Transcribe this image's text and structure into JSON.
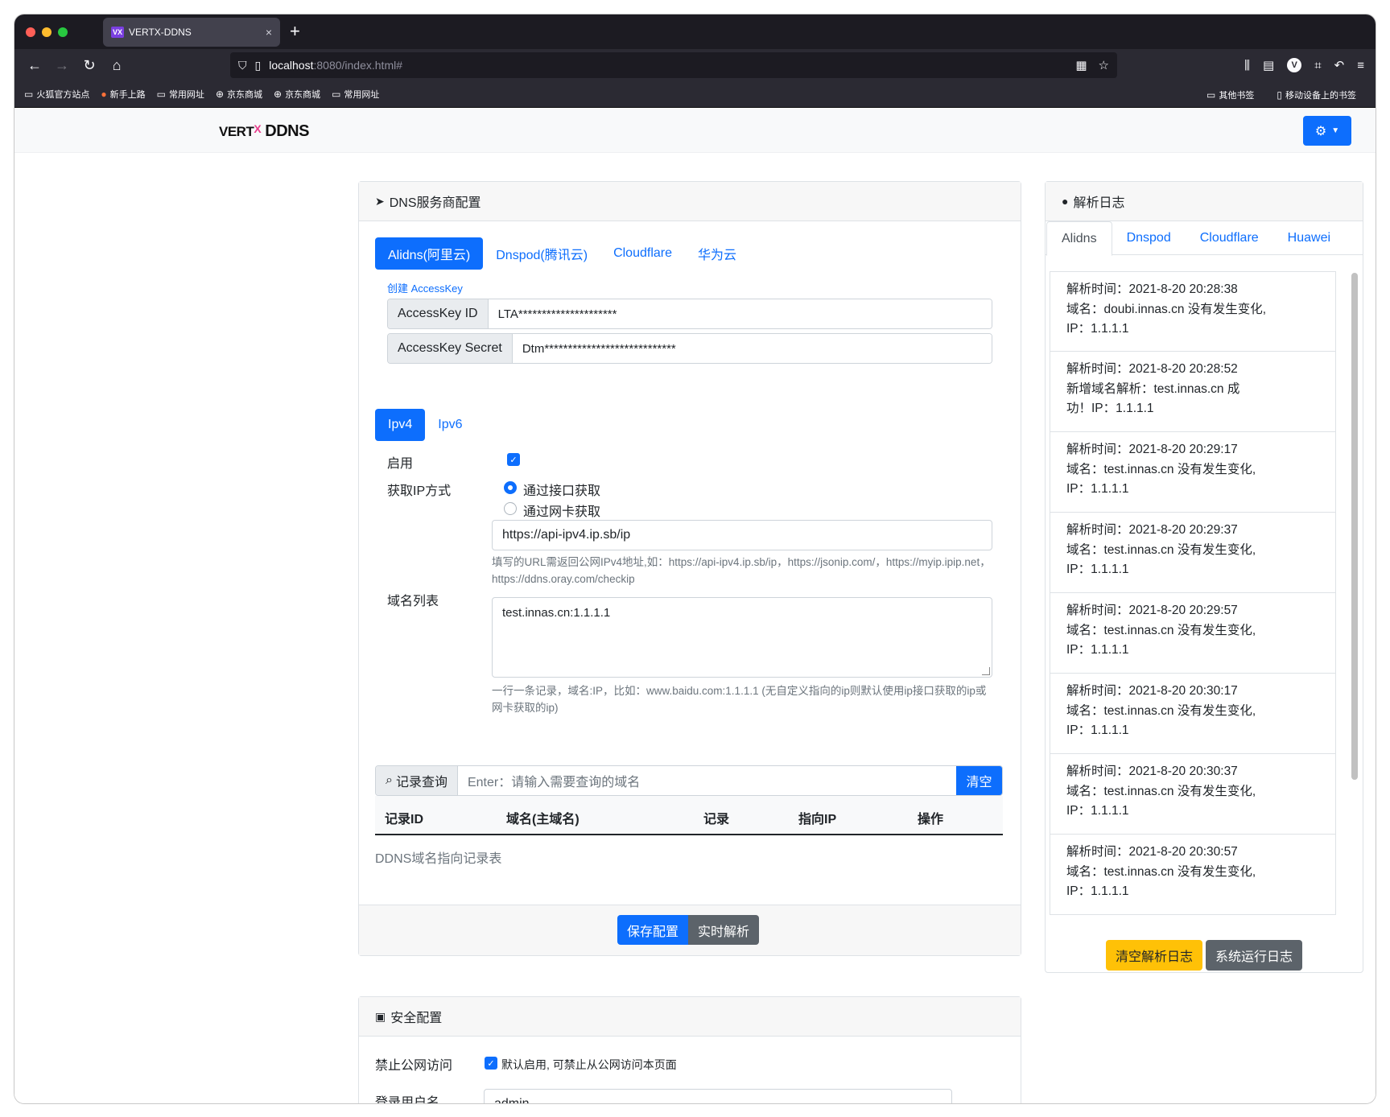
{
  "browser": {
    "tab_title": "VERTX-DDNS",
    "tab_favicon": "VX",
    "tab_close": "×",
    "new_tab": "+",
    "url_host": "localhost",
    "url_rest": ":8080/index.html#",
    "bookmarks": [
      {
        "icon": "folder-icon",
        "label": "火狐官方站点"
      },
      {
        "icon": "firefox-icon",
        "label": "新手上路"
      },
      {
        "icon": "folder-icon",
        "label": "常用网址"
      },
      {
        "icon": "globe-icon",
        "label": "京东商城"
      },
      {
        "icon": "globe-icon",
        "label": "京东商城"
      },
      {
        "icon": "folder-icon",
        "label": "常用网址"
      }
    ],
    "bookmarks_right": [
      {
        "icon": "folder-icon",
        "label": "其他书签"
      },
      {
        "icon": "mobile-icon",
        "label": "移动设备上的书签"
      }
    ],
    "extension_letter": "V"
  },
  "app": {
    "logo_main": "VERT",
    "logo_x": "X",
    "logo_suffix": "DDNS"
  },
  "dns_card": {
    "title": "DNS服务商配置",
    "provider_tabs": [
      "Alidns(阿里云)",
      "Dnspod(腾讯云)",
      "Cloudflare",
      "华为云"
    ],
    "active_provider": "Alidns(阿里云)",
    "create_key_link": "创建 AccessKey",
    "access_key_id_label": "AccessKey ID",
    "access_key_id_value": "LTA*********************",
    "access_key_secret_label": "AccessKey Secret",
    "access_key_secret_value": "Dtm****************************",
    "ip_tabs": [
      "Ipv4",
      "Ipv6"
    ],
    "enable_label": "启用",
    "get_ip_label": "获取IP方式",
    "radio_api": "通过接口获取",
    "radio_nic": "通过网卡获取",
    "api_url": "https://api-ipv4.ip.sb/ip",
    "api_help": "填写的URL需返回公网IPv4地址,如：https://api-ipv4.ip.sb/ip，https://jsonip.com/，https://myip.ipip.net，https://ddns.oray.com/checkip",
    "domain_list_label": "域名列表",
    "domain_list_value": "test.innas.cn:1.1.1.1",
    "domain_help": "一行一条记录，域名:IP，比如：www.baidu.com:1.1.1.1 (无自定义指向的ip则默认使用ip接口获取的ip或网卡获取的ip)",
    "search_label": "记录查询",
    "search_placeholder": "Enter：请输入需要查询的域名",
    "clear_button": "清空",
    "table_headers": [
      "记录ID",
      "域名(主域名)",
      "记录",
      "指向IP",
      "操作"
    ],
    "table_caption": "DDNS域名指向记录表",
    "save_button": "保存配置",
    "realtime_button": "实时解析"
  },
  "log_card": {
    "title": "解析日志",
    "tabs": [
      "Alidns",
      "Dnspod",
      "Cloudflare",
      "Huawei"
    ],
    "active_tab": "Alidns",
    "entries": [
      {
        "time": "解析时间：2021-8-20 20:28:38",
        "line2": "域名：doubi.innas.cn 没有发生变化,",
        "line3": "IP：1.1.1.1"
      },
      {
        "time": "解析时间：2021-8-20 20:28:52",
        "line2": "新增域名解析：test.innas.cn 成",
        "line3": "功！IP：1.1.1.1"
      },
      {
        "time": "解析时间：2021-8-20 20:29:17",
        "line2": "域名：test.innas.cn 没有发生变化,",
        "line3": "IP：1.1.1.1"
      },
      {
        "time": "解析时间：2021-8-20 20:29:37",
        "line2": "域名：test.innas.cn 没有发生变化,",
        "line3": "IP：1.1.1.1"
      },
      {
        "time": "解析时间：2021-8-20 20:29:57",
        "line2": "域名：test.innas.cn 没有发生变化,",
        "line3": "IP：1.1.1.1"
      },
      {
        "time": "解析时间：2021-8-20 20:30:17",
        "line2": "域名：test.innas.cn 没有发生变化,",
        "line3": "IP：1.1.1.1"
      },
      {
        "time": "解析时间：2021-8-20 20:30:37",
        "line2": "域名：test.innas.cn 没有发生变化,",
        "line3": "IP：1.1.1.1"
      },
      {
        "time": "解析时间：2021-8-20 20:30:57",
        "line2": "域名：test.innas.cn 没有发生变化,",
        "line3": "IP：1.1.1.1"
      }
    ],
    "clear_log_button": "清空解析日志",
    "system_log_button": "系统运行日志"
  },
  "security_card": {
    "title": "安全配置",
    "block_public_label": "禁止公网访问",
    "block_public_desc": "默认启用, 可禁止从公网访问本页面",
    "username_label": "登录用户名",
    "username_value": "admin"
  },
  "colors": {
    "primary": "#0d6efd",
    "secondary": "#5c636a",
    "warning": "#ffc107",
    "chrome_dark": "#1c1b22"
  }
}
